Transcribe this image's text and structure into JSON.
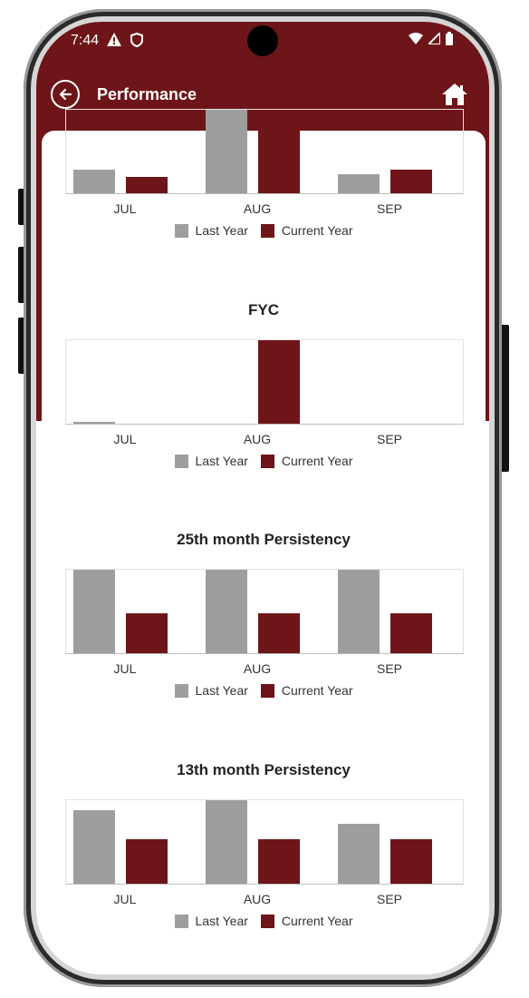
{
  "status_bar": {
    "time": "7:44",
    "left_icons": [
      "warning-icon",
      "shield-icon"
    ],
    "right_icons": [
      "wifi-icon",
      "signal-icon",
      "battery-icon"
    ]
  },
  "toolbar": {
    "title": "Performance",
    "back_icon": "back-arrow-icon",
    "home_icon": "home-icon"
  },
  "colors": {
    "brand": "#6e1519",
    "last_year": "#9e9e9e",
    "current_year": "#6e1519"
  },
  "legend": {
    "last_year": "Last Year",
    "current_year": "Current Year"
  },
  "chart_data": [
    {
      "type": "bar",
      "title": "",
      "categories": [
        "JUL",
        "AUG",
        "SEP"
      ],
      "series": [
        {
          "name": "Last Year",
          "values": [
            0.28,
            1.0,
            0.23
          ]
        },
        {
          "name": "Current Year",
          "values": [
            0.2,
            1.0,
            0.28
          ]
        }
      ],
      "ylim": [
        0,
        1
      ],
      "legend": "bottom"
    },
    {
      "type": "bar",
      "title": "FYC",
      "categories": [
        "JUL",
        "AUG",
        "SEP"
      ],
      "series": [
        {
          "name": "Last Year",
          "values": [
            0.02,
            0,
            0
          ]
        },
        {
          "name": "Current Year",
          "values": [
            0,
            1.0,
            0
          ]
        }
      ],
      "ylim": [
        0,
        1
      ],
      "legend": "bottom"
    },
    {
      "type": "bar",
      "title": "25th month Persistency",
      "categories": [
        "JUL",
        "AUG",
        "SEP"
      ],
      "series": [
        {
          "name": "Last Year",
          "values": [
            1.0,
            1.0,
            1.0
          ]
        },
        {
          "name": "Current Year",
          "values": [
            0.48,
            0.48,
            0.48
          ]
        }
      ],
      "ylim": [
        0,
        1
      ],
      "legend": "bottom"
    },
    {
      "type": "bar",
      "title": "13th month Persistency",
      "categories": [
        "JUL",
        "AUG",
        "SEP"
      ],
      "series": [
        {
          "name": "Last Year",
          "values": [
            0.88,
            1.0,
            0.72
          ]
        },
        {
          "name": "Current Year",
          "values": [
            0.53,
            0.53,
            0.53
          ]
        }
      ],
      "ylim": [
        0,
        1
      ],
      "legend": "bottom"
    }
  ]
}
